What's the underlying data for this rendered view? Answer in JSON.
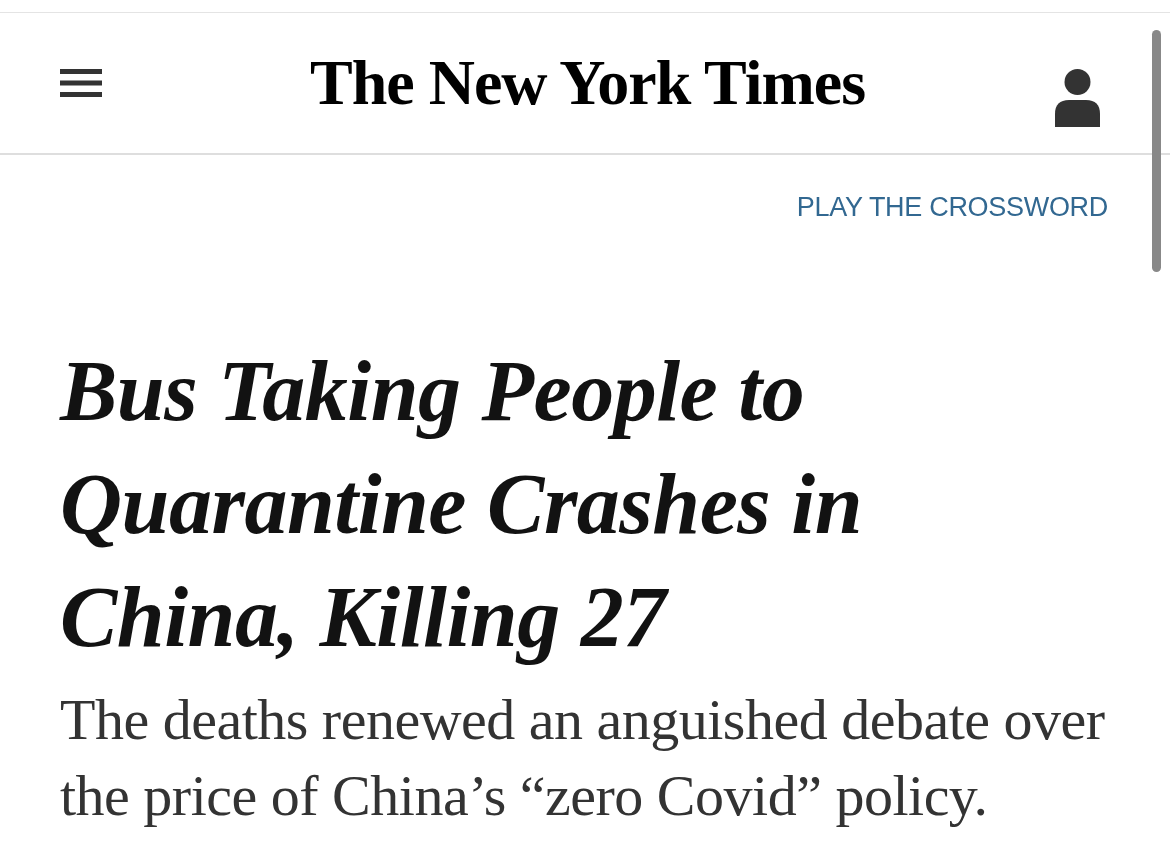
{
  "header": {
    "logo": "The New York Times"
  },
  "crossword_link": "PLAY THE CROSSWORD",
  "article": {
    "headline": "Bus Taking People to Quarantine Crashes in China, Killing 27",
    "summary": "The deaths renewed an anguished debate over the price of China’s “zero Covid” policy."
  }
}
